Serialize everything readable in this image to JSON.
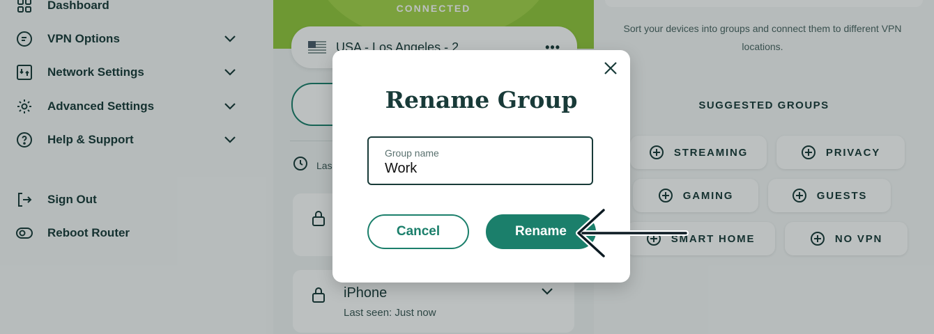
{
  "sidebar": {
    "items": [
      {
        "label": "Dashboard",
        "icon": "grid-icon",
        "expandable": false
      },
      {
        "label": "VPN Options",
        "icon": "vpn-shield-icon",
        "expandable": true
      },
      {
        "label": "Network Settings",
        "icon": "network-icon",
        "expandable": true
      },
      {
        "label": "Advanced Settings",
        "icon": "gear-icon",
        "expandable": true
      },
      {
        "label": "Help & Support",
        "icon": "help-icon",
        "expandable": true
      },
      {
        "label": "Sign Out",
        "icon": "sign-out-icon",
        "expandable": false
      },
      {
        "label": "Reboot Router",
        "icon": "toggle-icon",
        "expandable": false
      }
    ]
  },
  "middle": {
    "status": "CONNECTED",
    "location": "USA - Los Angeles - 2",
    "location_flag_icon": "usa-flag-icon",
    "more_icon": "more-dots-icon",
    "last_seen_partial": "Las",
    "devices": [
      {
        "name": "",
        "subtitle": ""
      },
      {
        "name": "iPhone",
        "subtitle": "Last seen: Just now"
      }
    ]
  },
  "right": {
    "description": "Sort your devices into groups and connect them to different VPN locations.",
    "suggested_title": "SUGGESTED GROUPS",
    "chips": [
      "STREAMING",
      "PRIVACY",
      "GAMING",
      "GUESTS",
      "SMART HOME",
      "NO VPN"
    ]
  },
  "modal": {
    "title": "Rename Group",
    "field_label": "Group name",
    "field_value": "Work",
    "cancel_label": "Cancel",
    "rename_label": "Rename"
  },
  "colors": {
    "primary": "#1b7f6b",
    "text_dark": "#183a38",
    "connected_green": "#93c83c",
    "overlay": "rgba(16,30,30,0.28)"
  }
}
